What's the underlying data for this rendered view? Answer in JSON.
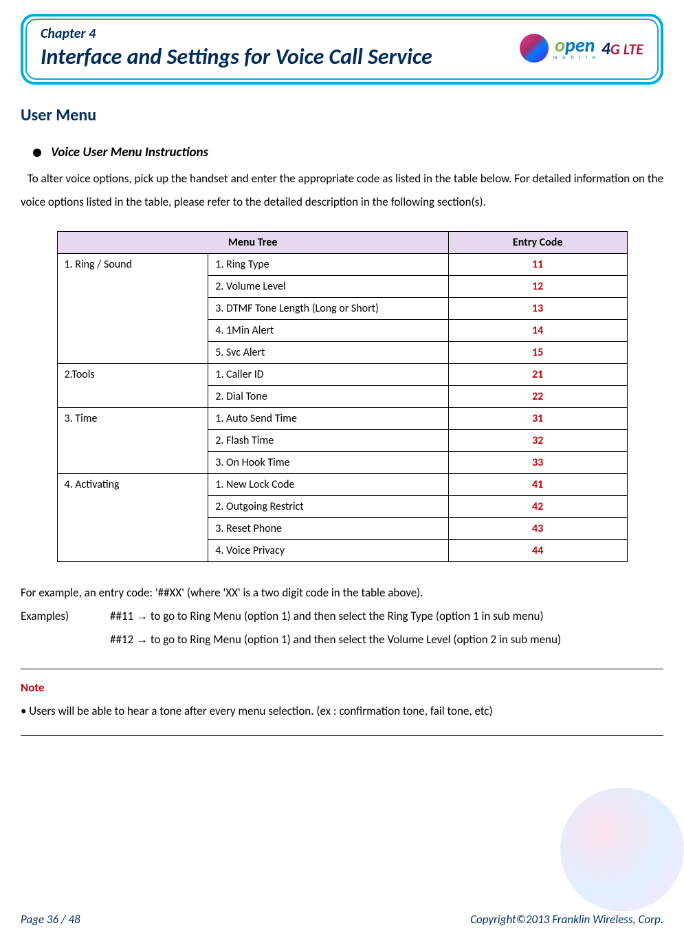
{
  "header": {
    "chapter_label": "Chapter 4",
    "title": "Interface and Settings for Voice Call Service",
    "open_word_o": "o",
    "open_word_pen": "pen",
    "open_mobile": "m o b i l e",
    "lte_four": "4",
    "lte_rest": "G LTE"
  },
  "section_title": "User Menu",
  "bullet_heading": "Voice User Menu Instructions",
  "intro_text": "To alter voice options, pick up the handset and enter the appropriate code as listed in the table below.   For detailed information on the voice options listed in the table, please refer to the detailed description in the following section(s).",
  "table": {
    "head_menu": "Menu Tree",
    "head_code": "Entry Code",
    "groups": [
      {
        "category": "1. Ring / Sound",
        "items": [
          {
            "label": "1. Ring Type",
            "code": "11"
          },
          {
            "label": "2. Volume Level",
            "code": "12"
          },
          {
            "label": "3. DTMF Tone Length (Long or Short)",
            "code": "13"
          },
          {
            "label": "4. 1Min Alert",
            "code": "14"
          },
          {
            "label": "5. Svc Alert",
            "code": "15"
          }
        ]
      },
      {
        "category": "2.Tools",
        "items": [
          {
            "label": "1. Caller ID",
            "code": "21"
          },
          {
            "label": "2. Dial Tone",
            "code": "22"
          }
        ]
      },
      {
        "category": "3. Time",
        "items": [
          {
            "label": "1. Auto Send Time",
            "code": "31"
          },
          {
            "label": "2. Flash Time",
            "code": "32"
          },
          {
            "label": "3. On Hook Time",
            "code": "33"
          }
        ]
      },
      {
        "category": "4. Activating",
        "items": [
          {
            "label": "1. New Lock Code",
            "code": "41"
          },
          {
            "label": "2. Outgoing Restrict",
            "code": "42"
          },
          {
            "label": "3. Reset Phone",
            "code": "43"
          },
          {
            "label": "4. Voice Privacy",
            "code": "44"
          }
        ]
      }
    ]
  },
  "examples": {
    "line1": "For example, an entry code: '##XX' (where 'XX' is a two digit code in the table above).",
    "label": "Examples)",
    "ex1_code": "##11 ",
    "ex1_rest": " to go to Ring Menu (option 1) and then select the Ring Type (option 1 in sub menu)",
    "ex2_code": "##12 ",
    "ex2_rest": " to go to Ring Menu (option 1) and then select the Volume Level (option 2 in sub menu)",
    "arrow": "→"
  },
  "note": {
    "label": "Note",
    "text": "• Users will be able to hear a tone after every menu selection. (ex : confirmation tone, fail tone, etc)"
  },
  "footer": {
    "left": "Page  36  /  48",
    "right": "Copyright©2013  Franklin  Wireless, Corp."
  }
}
